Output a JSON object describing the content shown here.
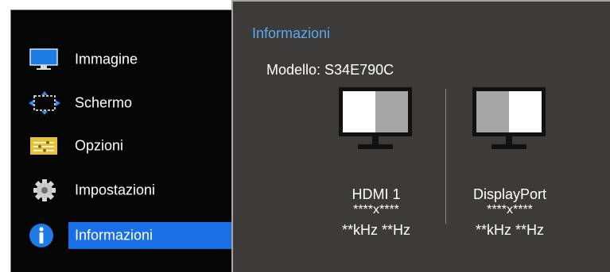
{
  "menu": {
    "items": [
      {
        "label": "Immagine",
        "icon": "monitor-icon"
      },
      {
        "label": "Schermo",
        "icon": "resize-arrows-icon"
      },
      {
        "label": "Opzioni",
        "icon": "options-sliders-icon"
      },
      {
        "label": "Impostazioni",
        "icon": "gear-icon"
      },
      {
        "label": "Informazioni",
        "icon": "info-icon",
        "selected": true
      }
    ]
  },
  "info": {
    "title": "Informazioni",
    "model_line": "Modello: S34E790C",
    "ports": [
      {
        "name": "HDMI 1",
        "resolution": "****x****",
        "frequency": "**kHz **Hz"
      },
      {
        "name": "DisplayPort",
        "resolution": "****x****",
        "frequency": "**kHz **Hz"
      }
    ]
  },
  "colors": {
    "menu_background": "#050505",
    "selected_highlight": "#1a6fe6",
    "panel_background": "#3d3b39",
    "title_accent": "#5aa9ec",
    "screen_light": "#ffffff",
    "screen_dark": "#a5a5a5"
  }
}
